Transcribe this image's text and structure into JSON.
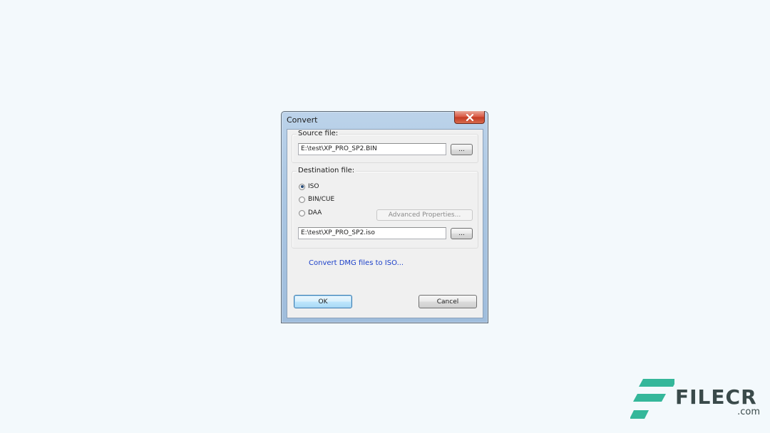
{
  "dialog": {
    "title": "Convert",
    "close_label": "×"
  },
  "source": {
    "group_label": "Source file:",
    "path_value": "E:\\test\\XP_PRO_SP2.BIN",
    "browse_label": "..."
  },
  "destination": {
    "group_label": "Destination file:",
    "options": [
      {
        "label": "ISO",
        "checked": true
      },
      {
        "label": "BIN/CUE",
        "checked": false
      },
      {
        "label": "DAA",
        "checked": false
      }
    ],
    "advanced_label": "Advanced Properties...",
    "path_value": "E:\\test\\XP_PRO_SP2.iso",
    "browse_label": "..."
  },
  "link": {
    "dmg_label": "Convert DMG files to ISO..."
  },
  "buttons": {
    "ok_label": "OK",
    "cancel_label": "Cancel"
  },
  "watermark": {
    "brand": "FILECR",
    "domain": ".com",
    "brand_color": "#34b79a"
  }
}
